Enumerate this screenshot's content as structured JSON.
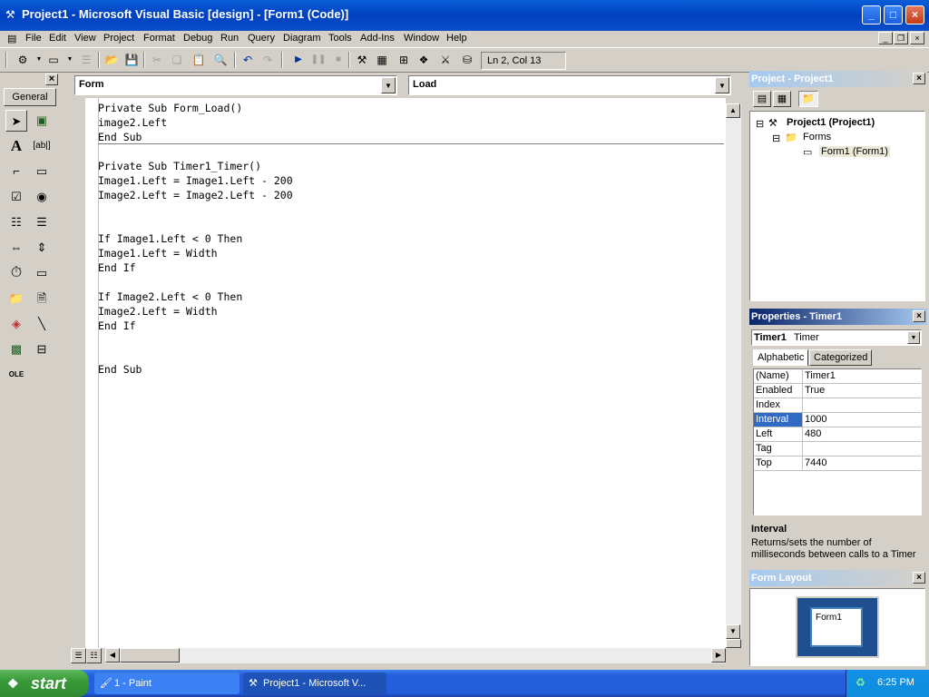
{
  "window": {
    "title": "Project1 - Microsoft Visual Basic [design] - [Form1 (Code)]",
    "caption_buttons": [
      "_",
      "□",
      "×"
    ]
  },
  "menu": [
    "File",
    "Edit",
    "View",
    "Project",
    "Format",
    "Debug",
    "Run",
    "Query",
    "Diagram",
    "Tools",
    "Add-Ins",
    "Window",
    "Help"
  ],
  "toolbar": {
    "status": "Ln 2, Col 13"
  },
  "toolbox": {
    "tab_label": "General"
  },
  "code": {
    "object_combo": "Form",
    "procedure_combo": "Load",
    "lines": [
      "Private Sub Form_Load()",
      "image2.Left",
      "End Sub",
      "",
      "Private Sub Timer1_Timer()",
      "Image1.Left = Image1.Left - 200",
      "Image2.Left = Image2.Left - 200",
      "",
      "",
      "If Image1.Left < 0 Then",
      "Image1.Left = Width",
      "End If",
      "",
      "If Image2.Left < 0 Then",
      "Image2.Left = Width",
      "End If",
      "",
      "",
      "End Sub"
    ]
  },
  "project": {
    "title": "Project - Project1",
    "root": "Project1 (Project1)",
    "folder": "Forms",
    "form": "Form1 (Form1)"
  },
  "properties": {
    "title": "Properties - Timer1",
    "object_name": "Timer1",
    "object_type": "Timer",
    "tabs": [
      "Alphabetic",
      "Categorized"
    ],
    "rows": [
      {
        "name": "(Name)",
        "value": "Timer1"
      },
      {
        "name": "Enabled",
        "value": "True"
      },
      {
        "name": "Index",
        "value": ""
      },
      {
        "name": "Interval",
        "value": "1000"
      },
      {
        "name": "Left",
        "value": "480"
      },
      {
        "name": "Tag",
        "value": ""
      },
      {
        "name": "Top",
        "value": "7440"
      }
    ],
    "selected": "Interval",
    "description_title": "Interval",
    "description": "Returns/sets the number of milliseconds between calls to a Timer"
  },
  "form_layout": {
    "title": "Form Layout",
    "form_label": "Form1"
  },
  "taskbar": {
    "start": "start",
    "tasks": [
      "1 - Paint",
      "Project1 - Microsoft V..."
    ],
    "clock": "6:25 PM"
  },
  "colors": {
    "title_blue": "#0040c0",
    "selection": "#316ac5",
    "start_green": "#3a9a3a"
  }
}
